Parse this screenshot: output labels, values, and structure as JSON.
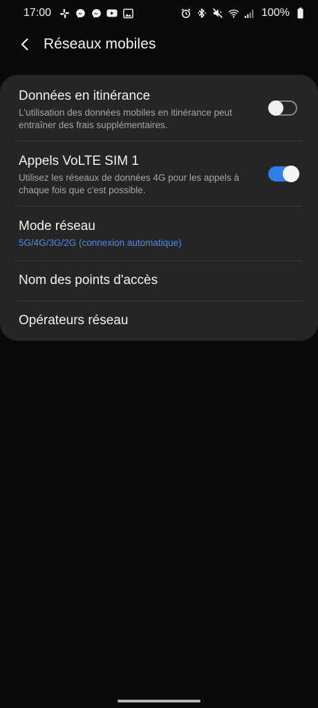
{
  "status_bar": {
    "time": "17:00",
    "battery_percent": "100%",
    "left_icons": [
      "slack-icon",
      "messenger-icon",
      "messenger-icon",
      "youtube-icon",
      "gallery-icon"
    ],
    "right_icons": [
      "alarm-icon",
      "bluetooth-icon",
      "mute-icon",
      "wifi-icon",
      "signal-icon",
      "battery-icon"
    ]
  },
  "header": {
    "title": "Réseaux mobiles"
  },
  "settings": [
    {
      "title": "Données en itinérance",
      "subtitle": "L'utilisation des données mobiles en itinérance peut entraîner des frais supplémentaires.",
      "toggle": false
    },
    {
      "title": "Appels VoLTE SIM 1",
      "subtitle": "Utilisez les réseaux de données 4G pour les appels à chaque fois que c'est possible.",
      "toggle": true
    },
    {
      "title": "Mode réseau",
      "value": "5G/4G/3G/2G (connexion automatique)"
    },
    {
      "title": "Nom des points d'accès"
    },
    {
      "title": "Opérateurs réseau"
    }
  ],
  "colors": {
    "accent": "#2f7fe6",
    "value_text": "#4c8dea",
    "card_bg": "#252525",
    "page_bg": "#0a0a0a"
  }
}
